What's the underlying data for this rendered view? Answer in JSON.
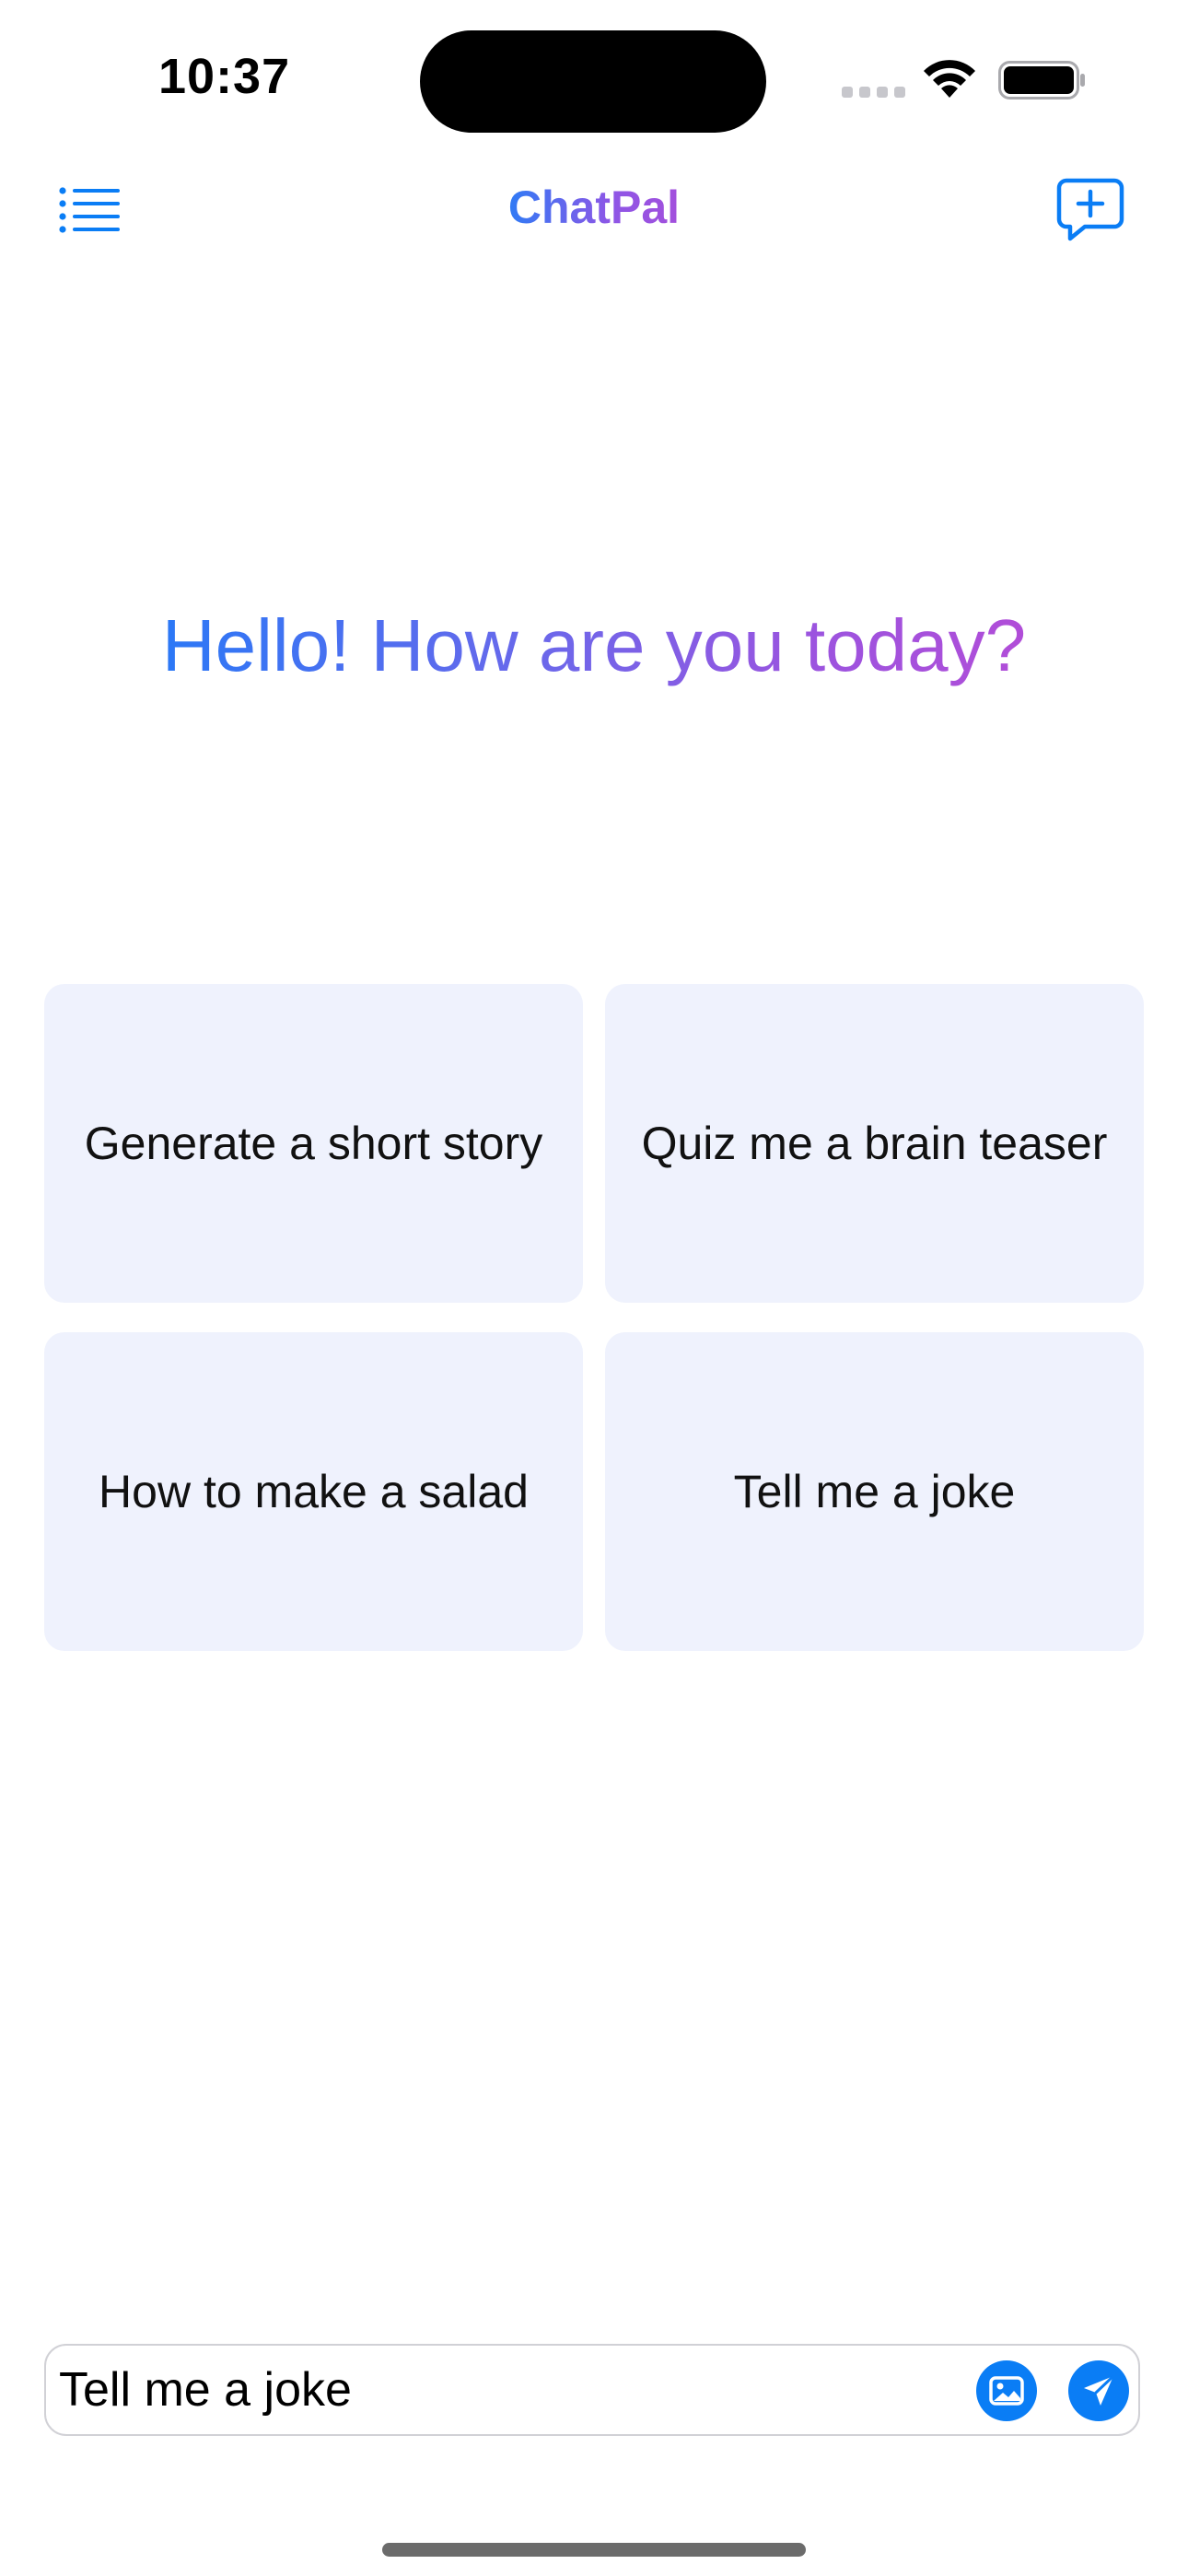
{
  "status_bar": {
    "time": "10:37"
  },
  "nav": {
    "title": "ChatPal",
    "menu_icon": "list-icon",
    "new_chat_icon": "new-chat-bubble-plus-icon"
  },
  "greeting": "Hello! How are you today?",
  "suggestions": [
    {
      "label": "Generate a short story"
    },
    {
      "label": "Quiz me a brain teaser"
    },
    {
      "label": "How to make a salad"
    },
    {
      "label": "Tell me a joke"
    }
  ],
  "composer": {
    "value": "Tell me a joke",
    "image_icon": "photo-icon",
    "send_icon": "paper-plane-icon"
  },
  "colors": {
    "accent": "#0a7df5",
    "gradient_start": "#2b78f6",
    "gradient_end": "#b14dd8",
    "card_background": "#eff2fd"
  }
}
